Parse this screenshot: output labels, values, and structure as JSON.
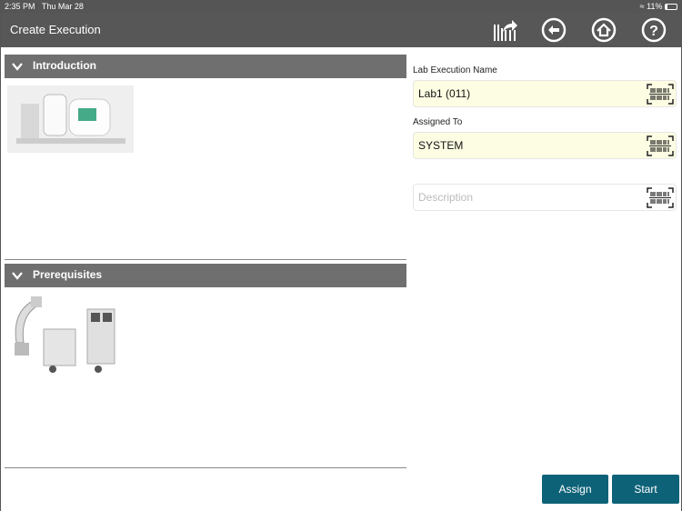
{
  "status_bar": {
    "time": "2:35 PM",
    "date": "Thu Mar 28",
    "battery": "11%"
  },
  "header": {
    "title": "Create Execution",
    "icons": [
      "barcode-share-icon",
      "back-arrow-icon",
      "home-icon",
      "help-icon"
    ]
  },
  "sections": [
    {
      "title": "Introduction"
    },
    {
      "title": "Prerequisites"
    }
  ],
  "form": {
    "lab_name_label": "Lab Execution Name",
    "lab_name_value": "Lab1 (011)",
    "assigned_label": "Assigned To",
    "assigned_value": "SYSTEM",
    "description_placeholder": "Description"
  },
  "buttons": {
    "assign": "Assign",
    "start": "Start"
  },
  "colors": {
    "header": "#575757",
    "section": "#6f6f6f",
    "button": "#0e6278",
    "field": "#fdfde3"
  }
}
